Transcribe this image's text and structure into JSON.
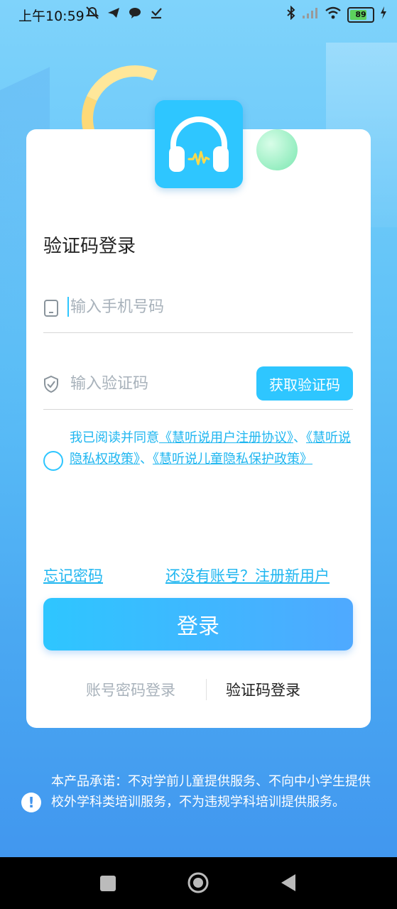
{
  "status_bar": {
    "time": "上午10:59",
    "battery": "89",
    "battery_fraction": 0.89
  },
  "login": {
    "title": "验证码登录",
    "phone_placeholder": "输入手机号码",
    "code_placeholder": "输入验证码",
    "get_code_button": "获取验证码",
    "agreement": {
      "prefix": "我已阅读并同意",
      "link1": "《慧听说用户注册协议》",
      "sep1": "、",
      "link2": "《慧听说隐私权政策》",
      "sep2": "、",
      "link3": "《慧听说儿童隐私保护政策》"
    },
    "forgot_password": "忘记密码",
    "register": "还没有账号？注册新用户",
    "login_button": "登录",
    "switch_password_login": "账号密码登录",
    "switch_code_login": "验证码登录"
  },
  "notice": {
    "icon": "!",
    "text": "本产品承诺：不对学前儿童提供服务、不向中小学生提供校外学科类培训服务，不为违规学科培训提供服务。"
  },
  "colors": {
    "accent": "#2ec6ff",
    "link": "#1fb6f0",
    "placeholder": "#a8b2bb"
  }
}
